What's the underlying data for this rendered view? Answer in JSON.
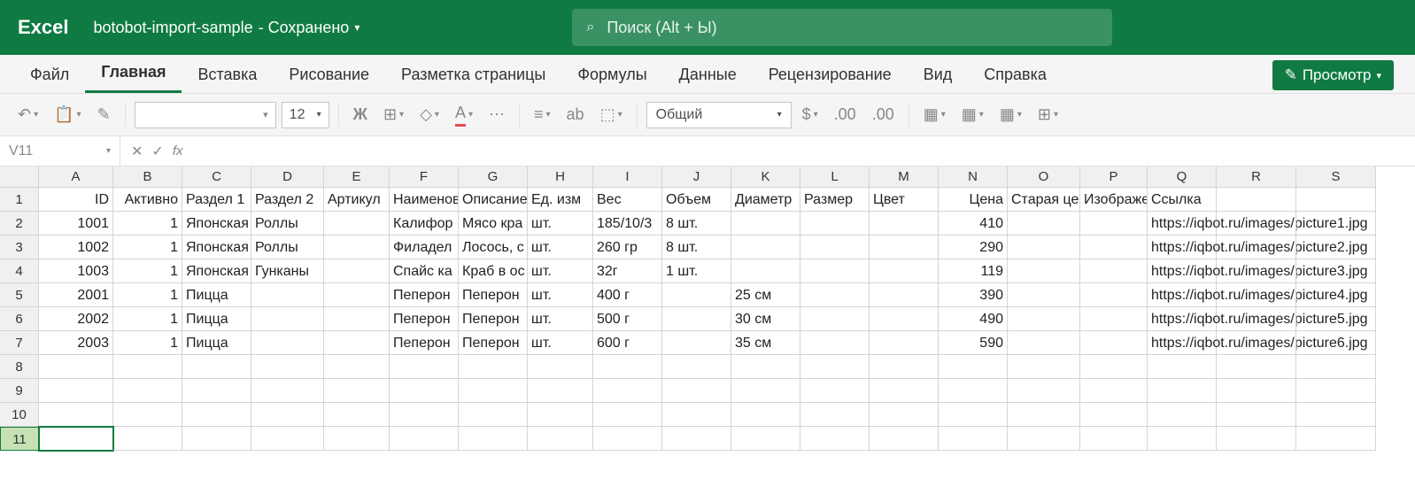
{
  "titlebar": {
    "app": "Excel",
    "doc": "botobot-import-sample",
    "saved": "- Сохранено",
    "search_placeholder": "Поиск (Alt + Ы)"
  },
  "tabs": [
    "Файл",
    "Главная",
    "Вставка",
    "Рисование",
    "Разметка страницы",
    "Формулы",
    "Данные",
    "Рецензирование",
    "Вид",
    "Справка"
  ],
  "active_tab": 1,
  "preview": "Просмотр",
  "toolbar": {
    "font_size": "12",
    "number_format": "Общий",
    "bold": "Ж",
    "fontcolor": "А"
  },
  "fbar": {
    "name": "V11"
  },
  "columns": [
    "A",
    "B",
    "C",
    "D",
    "E",
    "F",
    "G",
    "H",
    "I",
    "J",
    "K",
    "L",
    "M",
    "N",
    "O",
    "P",
    "Q",
    "R",
    "S"
  ],
  "chart_data": {
    "type": "table",
    "headers": [
      "ID",
      "Активно",
      "Раздел 1",
      "Раздел 2",
      "Артикул",
      "Наименование",
      "Описание",
      "Ед. изм",
      "Вес",
      "Объем",
      "Диаметр",
      "Размер",
      "Цвет",
      "Цена",
      "Старая цена",
      "Изображение",
      "Ссылка"
    ],
    "rows": [
      [
        "1001",
        "1",
        "Японская",
        "Роллы",
        "",
        "Калифор",
        "Мясо кра",
        "шт.",
        "185/10/3",
        "8 шт.",
        "",
        "",
        "",
        "410",
        "",
        "",
        "https://iqbot.ru/images/picture1.jpg"
      ],
      [
        "1002",
        "1",
        "Японская",
        "Роллы",
        "",
        "Филадел",
        "Лосось, с",
        "шт.",
        "260 гр",
        "8 шт.",
        "",
        "",
        "",
        "290",
        "",
        "",
        "https://iqbot.ru/images/picture2.jpg"
      ],
      [
        "1003",
        "1",
        "Японская",
        "Гунканы",
        "",
        "Спайс ка",
        "Краб в ос",
        "шт.",
        "32г",
        "1 шт.",
        "",
        "",
        "",
        "119",
        "",
        "",
        "https://iqbot.ru/images/picture3.jpg"
      ],
      [
        "2001",
        "1",
        "Пицца",
        "",
        "",
        "Пеперон",
        "Пеперон",
        "шт.",
        "400 г",
        "",
        "25 см",
        "",
        "",
        "390",
        "",
        "",
        "https://iqbot.ru/images/picture4.jpg"
      ],
      [
        "2002",
        "1",
        "Пицца",
        "",
        "",
        "Пеперон",
        "Пеперон",
        "шт.",
        "500 г",
        "",
        "30 см",
        "",
        "",
        "490",
        "",
        "",
        "https://iqbot.ru/images/picture5.jpg"
      ],
      [
        "2003",
        "1",
        "Пицца",
        "",
        "",
        "Пеперон",
        "Пеперон",
        "шт.",
        "600 г",
        "",
        "35 см",
        "",
        "",
        "590",
        "",
        "",
        "https://iqbot.ru/images/picture6.jpg"
      ]
    ]
  },
  "blank_rows": [
    "8",
    "9",
    "10"
  ],
  "selected_row": "11"
}
